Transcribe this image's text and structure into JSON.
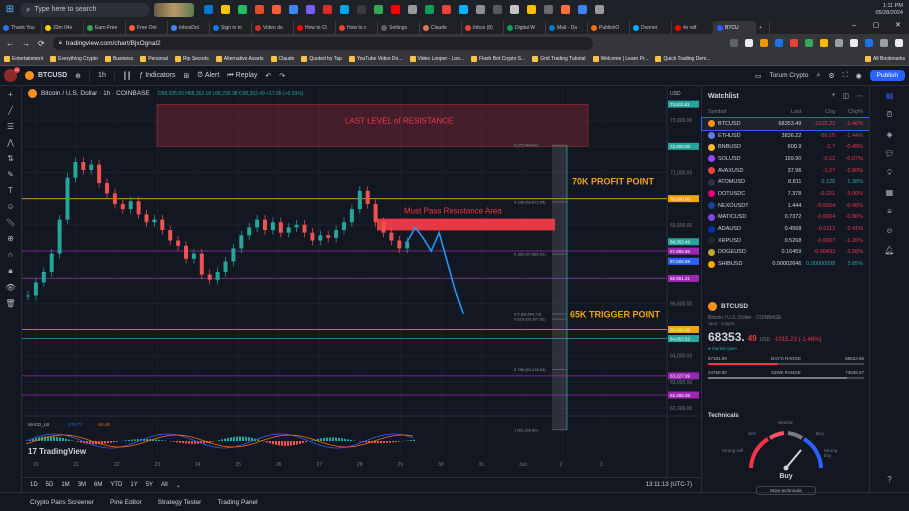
{
  "taskbar": {
    "search_placeholder": "Type here to search",
    "time": "1:11 PM",
    "date": "05/28/2024"
  },
  "browser": {
    "tabs": [
      "Thank You",
      "33m 04s",
      "Earn Free",
      "Free Onl",
      "InboxDol",
      "Sign in to",
      "Video do",
      "How to Cl",
      "How to c",
      "Settings",
      "Claude",
      "Inbox (8)",
      "Digital W",
      "Mail - Da",
      "PublishO",
      "Donner",
      "4x vdf",
      "BTCU"
    ],
    "active_tab": "BTCU",
    "url": "tradingview.com/chart/BjxOgnal2",
    "bookmarks": [
      "Entertainment",
      "Everything Crypto",
      "Business",
      "Personal",
      "Rip Secrets",
      "Alternative Assets",
      "Claude",
      "Quoted by Tap",
      "YouTube Video Do...",
      "Video Looper - Loo...",
      "Flash Bot Crypto S...",
      "Grid Trading Tutorial",
      "Welcome | Learn Pr...",
      "Quick Trading Dem...",
      "All Bookmarks"
    ]
  },
  "tv_toolbar": {
    "symbol": "BTCUSD",
    "interval": "1h",
    "indicators": "Indicators",
    "alert": "Alert",
    "replay": "Replay",
    "torum": "Torum Crypto",
    "publish": "Publish",
    "avatar_badge": "11"
  },
  "legend": {
    "title": "Bitcoin / U.S. Dollar · 1h · COINBASE",
    "ohlc": "O68,335.50 H68,362.18 L68,230.38 C68,353.49 +17.99 (+0.03%)"
  },
  "chart_data": {
    "type": "candlestick",
    "title": "Bitcoin / U.S. Dollar · 1h · COINBASE",
    "ylabel": "USD",
    "ylim": [
      62000,
      74000
    ],
    "x_labels": [
      "20",
      "21",
      "22",
      "23",
      "24",
      "25",
      "26",
      "27",
      "28",
      "29",
      "30",
      "31",
      "Jun",
      "2",
      "3"
    ],
    "price_ticks": [
      73000,
      72000,
      71000,
      70000,
      69000,
      68000,
      67000,
      66000,
      65000,
      64000,
      63000,
      62000
    ],
    "price_tags": [
      {
        "label": "73,611.61",
        "value": 73612,
        "color": "#26a69a"
      },
      {
        "label": "72,000.00",
        "value": 72000,
        "color": "#26a69a"
      },
      {
        "label": "70,000.00",
        "value": 70000,
        "color": "#f0a30a"
      },
      {
        "label": "68,353.49",
        "value": 68353,
        "color": "#26a69a"
      },
      {
        "label": "67,995.86",
        "value": 67996,
        "color": "#9c27b0"
      },
      {
        "label": "67,605.69",
        "value": 67606,
        "color": "#2962ff"
      },
      {
        "label": "66,951.21",
        "value": 66951,
        "color": "#9c27b0"
      },
      {
        "label": "65,000.00",
        "value": 65000,
        "color": "#f0a30a"
      },
      {
        "label": "64,652.52",
        "value": 64653,
        "color": "#26a69a"
      },
      {
        "label": "63,227.99",
        "value": 63228,
        "color": "#9c27b0"
      },
      {
        "label": "62,498.08",
        "value": 62498,
        "color": "#9c27b0"
      }
    ],
    "fib_levels": [
      {
        "label": "0 (72,044.62)",
        "value": 72045
      },
      {
        "label": "0.236 (69,872.05)",
        "value": 69872
      },
      {
        "label": "0.382 (67,880.51)",
        "value": 67881
      },
      {
        "label": "0.5 (65,594.23)",
        "value": 65594
      },
      {
        "label": "0.618 (65,397.92)",
        "value": 65398
      },
      {
        "label": "0.786 (63,476.59)",
        "value": 63477
      },
      {
        "label": "1 (61,165.80)",
        "value": 61166
      }
    ],
    "annotations": [
      {
        "text": "LAST LEVEL of RESISTANCE",
        "kind": "zone",
        "from": 72000,
        "to": 73600
      },
      {
        "text": "70K PROFIT POINT",
        "value": 70000
      },
      {
        "text": "Must Pass Resistance Area",
        "kind": "zone",
        "from": 68900,
        "to": 69200
      },
      {
        "text": "65K TRIGGER POINT",
        "value": 65000
      }
    ],
    "horizontal_lines": [
      {
        "value": 70000,
        "color": "#f0a30a"
      },
      {
        "value": 68000,
        "color": "#9c27b0"
      },
      {
        "value": 66950,
        "color": "#9c27b0"
      },
      {
        "value": 65000,
        "color": "#f0a30a"
      },
      {
        "value": 64650,
        "color": "#26a69a"
      },
      {
        "value": 63228,
        "color": "#9c27b0"
      },
      {
        "value": 62498,
        "color": "#9c27b0"
      }
    ],
    "candles_close": [
      66300,
      66800,
      67200,
      67900,
      69200,
      70800,
      71400,
      71100,
      71300,
      70600,
      70200,
      69800,
      69600,
      69900,
      69400,
      69100,
      69200,
      68800,
      68400,
      68200,
      67700,
      67900,
      67100,
      66900,
      67200,
      67600,
      68100,
      68600,
      68900,
      69200,
      68800,
      69100,
      68700,
      68900,
      69000,
      68700,
      68400,
      68600,
      68500,
      68800,
      69100,
      69600,
      70300,
      69800,
      69100,
      68700,
      68400,
      68100,
      68350
    ],
    "projected_path": [
      68350,
      68900,
      68500,
      68000,
      68700,
      67600,
      66500,
      65600
    ],
    "macd": {
      "label": "MACD_LB",
      "values": [
        "-278.71",
        "-54.49"
      ]
    }
  },
  "timeframes": [
    "1D",
    "5D",
    "1M",
    "3M",
    "6M",
    "YTD",
    "1Y",
    "5Y",
    "All"
  ],
  "tf_time": "13:11:13 (UTC-7)",
  "bottom_panels": [
    "Crypto Pairs Screener",
    "Pine Editor",
    "Strategy Tester",
    "Trading Panel"
  ],
  "watchlist": {
    "title": "Watchlist",
    "columns": [
      "Symbol",
      "Last",
      "Chg",
      "Chg%"
    ],
    "rows": [
      {
        "symbol": "BTCUSD",
        "last": "68353.49",
        "chg": "-1015.23",
        "chgp": "-1.46%",
        "color": "#f7931a"
      },
      {
        "symbol": "ETHUSD",
        "last": "3836.22",
        "chg": "-56.15",
        "chgp": "-1.44%",
        "color": "#627eea"
      },
      {
        "symbol": "BNBUSD",
        "last": "600.9",
        "chg": "-2.7",
        "chgp": "-0.45%",
        "color": "#f3ba2f"
      },
      {
        "symbol": "SOLUSD",
        "last": "169.90",
        "chg": "-0.12",
        "chgp": "-0.07%",
        "color": "#9945ff"
      },
      {
        "symbol": "AVAXUSD",
        "last": "37.96",
        "chg": "-1.07",
        "chgp": "-2.80%",
        "color": "#e84142"
      },
      {
        "symbol": "ATOMUSD",
        "last": "8.811",
        "chg": "0.128",
        "chgp": "1.38%",
        "color": "#2e3148"
      },
      {
        "symbol": "DOTUSDC",
        "last": "7.378",
        "chg": "-0.221",
        "chgp": "-3.00%",
        "color": "#e6007a"
      },
      {
        "symbol": "NEXOUSDT",
        "last": "1.444",
        "chg": "-0.0064",
        "chgp": "-0.45%",
        "color": "#1a4199"
      },
      {
        "symbol": "MATICUSD",
        "last": "0.7372",
        "chg": "-0.0064",
        "chgp": "-0.86%",
        "color": "#8247e5"
      },
      {
        "symbol": "ADAUSD",
        "last": "0.4568",
        "chg": "-0.0113",
        "chgp": "-2.41%",
        "color": "#0033ad"
      },
      {
        "symbol": "XRPUSD",
        "last": "0.5268",
        "chg": "-0.0067",
        "chgp": "-1.26%",
        "color": "#23292f"
      },
      {
        "symbol": "DOGEUSD",
        "last": "0.16459",
        "chg": "-0.00433",
        "chgp": "-2.56%",
        "color": "#c2a633"
      },
      {
        "symbol": "SHIBUSD",
        "last": "0.00002646",
        "chg": "0.00000098",
        "chgp": "3.85%",
        "color": "#ffa409"
      }
    ]
  },
  "detail": {
    "symbol": "BTCUSD",
    "subtitle": "Bitcoin / U.S. Dollar · COINBASE",
    "sub2": "Spot · Crypto",
    "price_main": "68353.",
    "price_dec": "49",
    "unit": "USD",
    "change": "-1015.23 (-1.46%)",
    "market": "● Market open",
    "days_low": "67184.59",
    "days_high": "69533.96",
    "days_label": "DAY'S RANGE",
    "days_pos": 0.45,
    "wk_low": "24750.00",
    "wk_high": "73835.57",
    "wk_label": "52WK RANGE",
    "wk_pos": 0.89
  },
  "technicals": {
    "title": "Technicals",
    "neutral": "Neutral",
    "sell": "Sell",
    "buy": "Buy",
    "strong_sell": "Strong sell",
    "strong_buy": "Strong buy",
    "result": "Buy",
    "more": "More technicals"
  }
}
